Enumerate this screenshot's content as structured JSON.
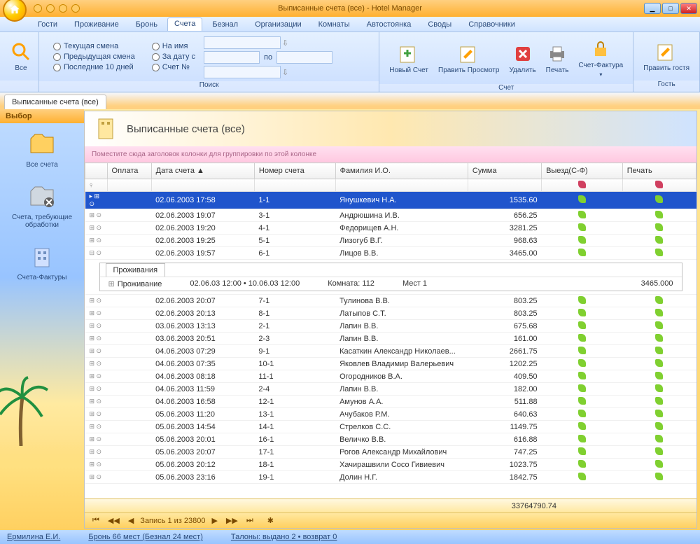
{
  "window": {
    "title": "Выписанные счета (все) - Hotel Manager",
    "min": "▁",
    "max": "□",
    "close": "✕"
  },
  "menu": {
    "items": [
      "Гости",
      "Проживание",
      "Бронь",
      "Счета",
      "Безнал",
      "Организации",
      "Комнаты",
      "Автостоянка",
      "Своды",
      "Справочники"
    ],
    "active_index": 3
  },
  "ribbon": {
    "all_btn": "Все",
    "search_group": "Поиск",
    "radios_col1": [
      "Текущая смена",
      "Предыдущая смена",
      "Последние 10 дней"
    ],
    "radios_col2": [
      "На имя",
      "За дату с",
      "Счет №"
    ],
    "po": "по",
    "bill_group": "Счет",
    "guest_group": "Гость",
    "btn_new": "Новый Счет",
    "btn_edit": "Править Просмотр",
    "btn_delete": "Удалить",
    "btn_print": "Печать",
    "btn_invoice": "Счет-Фактура",
    "btn_editguest": "Править гостя"
  },
  "tab": {
    "label": "Выписанные счета (все)"
  },
  "sidebar": {
    "header": "Выбор",
    "items": [
      {
        "label": "Все счета"
      },
      {
        "label": "Счета, требующие обработки"
      },
      {
        "label": "Счета-Фактуры"
      }
    ]
  },
  "main": {
    "title": "Выписанные счета (все)",
    "group_hint": "Поместите сюда заголовок колонки для группировки по этой колонке",
    "columns": [
      "Оплата",
      "Дата счета",
      "Номер счета",
      "Фамилия И.О.",
      "Сумма",
      "Выезд(С-Ф)",
      "Печать"
    ],
    "rows": [
      {
        "date": "02.06.2003 17:58",
        "num": "1-1",
        "name": "Янушкевич Н.А.",
        "sum": "1535.60",
        "sel": true
      },
      {
        "date": "02.06.2003 19:07",
        "num": "3-1",
        "name": "Андрюшина И.В.",
        "sum": "656.25"
      },
      {
        "date": "02.06.2003 19:20",
        "num": "4-1",
        "name": "Федорищев А.Н.",
        "sum": "3281.25"
      },
      {
        "date": "02.06.2003 19:25",
        "num": "5-1",
        "name": "Лизогуб В.Г.",
        "sum": "968.63"
      },
      {
        "date": "02.06.2003 19:57",
        "num": "6-1",
        "name": "Лицов В.В.",
        "sum": "3465.00",
        "expanded": true
      },
      {
        "date": "02.06.2003 20:07",
        "num": "7-1",
        "name": "Тулинова В.В.",
        "sum": "803.25"
      },
      {
        "date": "02.06.2003 20:13",
        "num": "8-1",
        "name": "Латыпов С.Т.",
        "sum": "803.25"
      },
      {
        "date": "03.06.2003 13:13",
        "num": "2-1",
        "name": "Лапин В.В.",
        "sum": "675.68"
      },
      {
        "date": "03.06.2003 20:51",
        "num": "2-3",
        "name": "Лапин В.В.",
        "sum": "161.00"
      },
      {
        "date": "04.06.2003 07:29",
        "num": "9-1",
        "name": "Касаткин Александр Николаев...",
        "sum": "2661.75"
      },
      {
        "date": "04.06.2003 07:35",
        "num": "10-1",
        "name": "Яковлев Владимир Валерьевич",
        "sum": "1202.25"
      },
      {
        "date": "04.06.2003 08:18",
        "num": "11-1",
        "name": "Огородников В.А.",
        "sum": "409.50"
      },
      {
        "date": "04.06.2003 11:59",
        "num": "2-4",
        "name": "Лапин В.В.",
        "sum": "182.00"
      },
      {
        "date": "04.06.2003 16:58",
        "num": "12-1",
        "name": "Амунов А.А.",
        "sum": "511.88"
      },
      {
        "date": "05.06.2003 11:20",
        "num": "13-1",
        "name": "Ачубаков Р.М.",
        "sum": "640.63"
      },
      {
        "date": "05.06.2003 14:54",
        "num": "14-1",
        "name": "Стрелков С.С.",
        "sum": "1149.75"
      },
      {
        "date": "05.06.2003 20:01",
        "num": "16-1",
        "name": "Величко В.В.",
        "sum": "616.88"
      },
      {
        "date": "05.06.2003 20:07",
        "num": "17-1",
        "name": "Рогов Александр Михайлович",
        "sum": "747.25"
      },
      {
        "date": "05.06.2003 20:12",
        "num": "18-1",
        "name": "Хачирашвили Сосо Гивиевич",
        "sum": "1023.75"
      },
      {
        "date": "05.06.2003 23:16",
        "num": "19-1",
        "name": "Долин Н.Г.",
        "sum": "1842.75"
      }
    ],
    "detail": {
      "tab": "Проживания",
      "label": "Проживание",
      "period": "02.06.03 12:00 • 10.06.03 12:00",
      "room": "Комната: 112",
      "beds": "Мест 1",
      "amount": "3465.000"
    },
    "footer_total": "33764790.74",
    "nav": {
      "record": "Запись 1 из 23800"
    }
  },
  "status": {
    "user": "Ермилина Е.И.",
    "booking": "Бронь 66 мест (Безнал 24 мест)",
    "coupons": "Талоны: выдано 2 • возврат 0"
  }
}
